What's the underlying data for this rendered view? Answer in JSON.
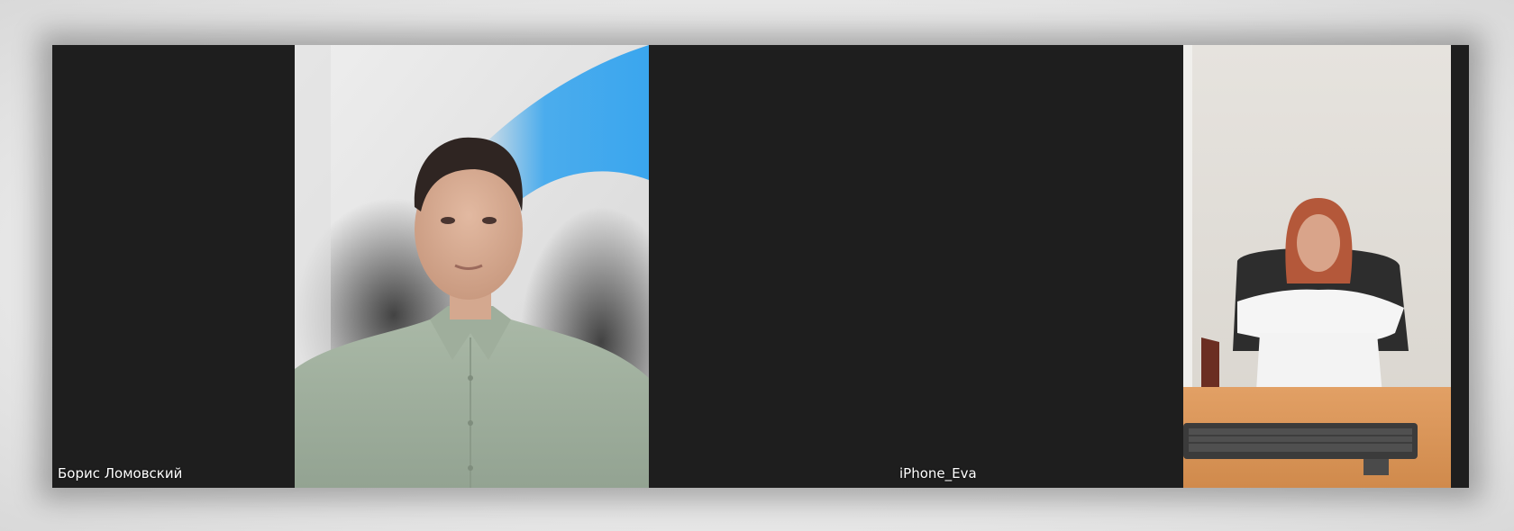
{
  "meeting": {
    "participants": [
      {
        "display_name": "Борис Ломовский",
        "video": "male-participant-camera-feed"
      },
      {
        "display_name": "iPhone_Eva",
        "video": "female-participant-camera-feed"
      }
    ]
  },
  "colors": {
    "tile_background": "#1e1e1e",
    "name_text": "#ffffff",
    "accent_blue": "#3aa6ee"
  }
}
